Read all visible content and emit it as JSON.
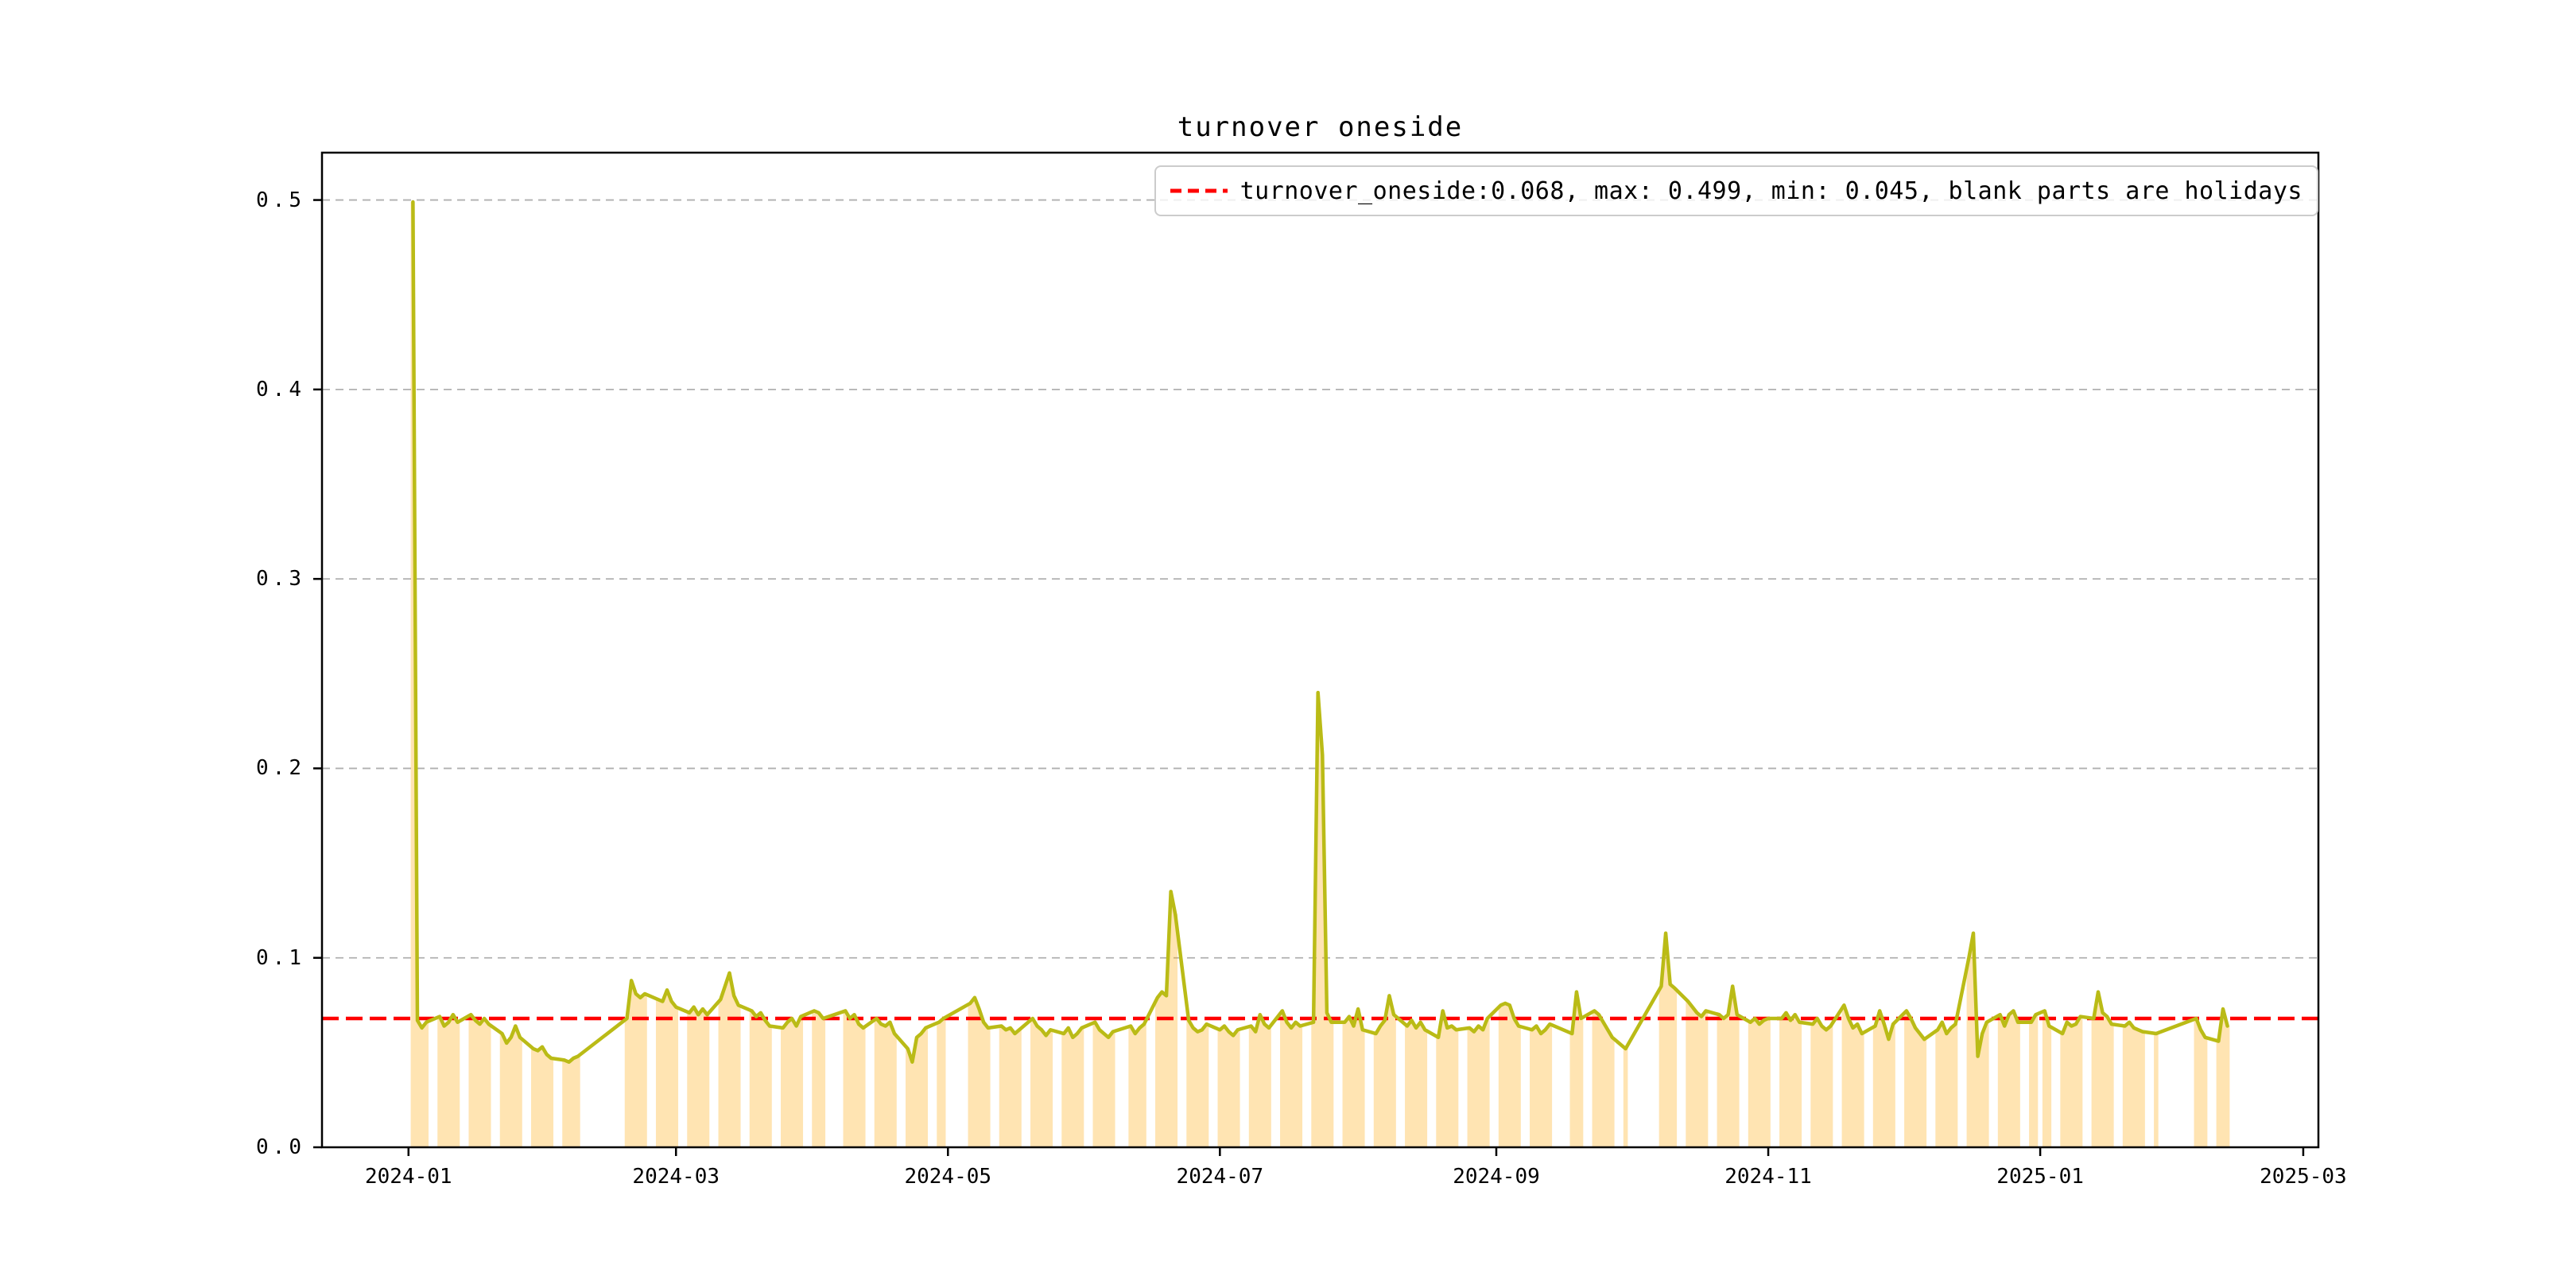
{
  "title": "turnover oneside",
  "legend": {
    "label": "turnover_oneside:0.068, max: 0.499, min: 0.045, blank parts are holidays",
    "dash_icon": "red-dashed-line-sample"
  },
  "colors": {
    "line": "#babb16",
    "fill": "rgba(255,165,0,0.30)",
    "hline": "#ff0000",
    "grid": "#b0b0b0",
    "spine": "#000000",
    "legend_border": "#cccccc"
  },
  "chart_data": {
    "type": "line",
    "title": "turnover oneside",
    "xlabel": "",
    "ylabel": "",
    "grid": true,
    "legend_position": "upper right",
    "hline": 0.068,
    "stats": {
      "turnover_oneside": 0.068,
      "max": 0.499,
      "min": 0.045,
      "note": "blank parts are holidays"
    },
    "ylim": [
      0,
      0.525
    ],
    "x_epoch": "2024-01-01",
    "xlim_days": [
      -19.4,
      428.4
    ],
    "yticks": [
      {
        "v": 0.0,
        "label": "0.0"
      },
      {
        "v": 0.1,
        "label": "0.1"
      },
      {
        "v": 0.2,
        "label": "0.2"
      },
      {
        "v": 0.3,
        "label": "0.3"
      },
      {
        "v": 0.4,
        "label": "0.4"
      },
      {
        "v": 0.5,
        "label": "0.5"
      }
    ],
    "xticks": [
      {
        "date": "2024-01-01",
        "label": "2024-01"
      },
      {
        "date": "2024-03-01",
        "label": "2024-03"
      },
      {
        "date": "2024-05-01",
        "label": "2024-05"
      },
      {
        "date": "2024-07-01",
        "label": "2024-07"
      },
      {
        "date": "2024-09-01",
        "label": "2024-09"
      },
      {
        "date": "2024-11-01",
        "label": "2024-11"
      },
      {
        "date": "2025-01-01",
        "label": "2025-01"
      },
      {
        "date": "2025-03-01",
        "label": "2025-03"
      }
    ],
    "series": [
      [
        "2024-01-02",
        0.499
      ],
      [
        "2024-01-03",
        0.067
      ],
      [
        "2024-01-04",
        0.063
      ],
      [
        "2024-01-05",
        0.066
      ],
      [
        "2024-01-08",
        0.069
      ],
      [
        "2024-01-09",
        0.064
      ],
      [
        "2024-01-10",
        0.066
      ],
      [
        "2024-01-11",
        0.07
      ],
      [
        "2024-01-12",
        0.066
      ],
      [
        "2024-01-15",
        0.07
      ],
      [
        "2024-01-16",
        0.067
      ],
      [
        "2024-01-17",
        0.065
      ],
      [
        "2024-01-18",
        0.068
      ],
      [
        "2024-01-19",
        0.065
      ],
      [
        "2024-01-22",
        0.06
      ],
      [
        "2024-01-23",
        0.055
      ],
      [
        "2024-01-24",
        0.058
      ],
      [
        "2024-01-25",
        0.064
      ],
      [
        "2024-01-26",
        0.058
      ],
      [
        "2024-01-29",
        0.052
      ],
      [
        "2024-01-30",
        0.051
      ],
      [
        "2024-01-31",
        0.053
      ],
      [
        "2024-02-01",
        0.049
      ],
      [
        "2024-02-02",
        0.047
      ],
      [
        "2024-02-05",
        0.046
      ],
      [
        "2024-02-06",
        0.045
      ],
      [
        "2024-02-07",
        0.047
      ],
      [
        "2024-02-08",
        0.048
      ],
      [
        "2024-02-19",
        0.068
      ],
      [
        "2024-02-20",
        0.088
      ],
      [
        "2024-02-21",
        0.081
      ],
      [
        "2024-02-22",
        0.079
      ],
      [
        "2024-02-23",
        0.081
      ],
      [
        "2024-02-26",
        0.078
      ],
      [
        "2024-02-27",
        0.077
      ],
      [
        "2024-02-28",
        0.083
      ],
      [
        "2024-02-29",
        0.077
      ],
      [
        "2024-03-01",
        0.074
      ],
      [
        "2024-03-04",
        0.071
      ],
      [
        "2024-03-05",
        0.074
      ],
      [
        "2024-03-06",
        0.07
      ],
      [
        "2024-03-07",
        0.073
      ],
      [
        "2024-03-08",
        0.07
      ],
      [
        "2024-03-11",
        0.078
      ],
      [
        "2024-03-12",
        0.085
      ],
      [
        "2024-03-13",
        0.092
      ],
      [
        "2024-03-14",
        0.08
      ],
      [
        "2024-03-15",
        0.075
      ],
      [
        "2024-03-18",
        0.072
      ],
      [
        "2024-03-19",
        0.069
      ],
      [
        "2024-03-20",
        0.071
      ],
      [
        "2024-03-21",
        0.067
      ],
      [
        "2024-03-22",
        0.064
      ],
      [
        "2024-03-25",
        0.063
      ],
      [
        "2024-03-26",
        0.066
      ],
      [
        "2024-03-27",
        0.068
      ],
      [
        "2024-03-28",
        0.064
      ],
      [
        "2024-03-29",
        0.069
      ],
      [
        "2024-04-01",
        0.072
      ],
      [
        "2024-04-02",
        0.071
      ],
      [
        "2024-04-03",
        0.068
      ],
      [
        "2024-04-08",
        0.072
      ],
      [
        "2024-04-09",
        0.068
      ],
      [
        "2024-04-10",
        0.07
      ],
      [
        "2024-04-11",
        0.065
      ],
      [
        "2024-04-12",
        0.063
      ],
      [
        "2024-04-15",
        0.068
      ],
      [
        "2024-04-16",
        0.065
      ],
      [
        "2024-04-17",
        0.064
      ],
      [
        "2024-04-18",
        0.066
      ],
      [
        "2024-04-19",
        0.06
      ],
      [
        "2024-04-22",
        0.052
      ],
      [
        "2024-04-23",
        0.045
      ],
      [
        "2024-04-24",
        0.058
      ],
      [
        "2024-04-25",
        0.06
      ],
      [
        "2024-04-26",
        0.063
      ],
      [
        "2024-04-29",
        0.066
      ],
      [
        "2024-04-30",
        0.068
      ],
      [
        "2024-05-06",
        0.076
      ],
      [
        "2024-05-07",
        0.079
      ],
      [
        "2024-05-08",
        0.073
      ],
      [
        "2024-05-09",
        0.066
      ],
      [
        "2024-05-10",
        0.063
      ],
      [
        "2024-05-13",
        0.064
      ],
      [
        "2024-05-14",
        0.062
      ],
      [
        "2024-05-15",
        0.063
      ],
      [
        "2024-05-16",
        0.06
      ],
      [
        "2024-05-17",
        0.062
      ],
      [
        "2024-05-20",
        0.068
      ],
      [
        "2024-05-21",
        0.064
      ],
      [
        "2024-05-22",
        0.062
      ],
      [
        "2024-05-23",
        0.059
      ],
      [
        "2024-05-24",
        0.062
      ],
      [
        "2024-05-27",
        0.06
      ],
      [
        "2024-05-28",
        0.063
      ],
      [
        "2024-05-29",
        0.058
      ],
      [
        "2024-05-30",
        0.06
      ],
      [
        "2024-05-31",
        0.063
      ],
      [
        "2024-06-03",
        0.066
      ],
      [
        "2024-06-04",
        0.062
      ],
      [
        "2024-06-05",
        0.06
      ],
      [
        "2024-06-06",
        0.058
      ],
      [
        "2024-06-07",
        0.061
      ],
      [
        "2024-06-11",
        0.064
      ],
      [
        "2024-06-12",
        0.06
      ],
      [
        "2024-06-13",
        0.063
      ],
      [
        "2024-06-14",
        0.065
      ],
      [
        "2024-06-17",
        0.079
      ],
      [
        "2024-06-18",
        0.082
      ],
      [
        "2024-06-19",
        0.08
      ],
      [
        "2024-06-20",
        0.135
      ],
      [
        "2024-06-21",
        0.123
      ],
      [
        "2024-06-24",
        0.067
      ],
      [
        "2024-06-25",
        0.063
      ],
      [
        "2024-06-26",
        0.061
      ],
      [
        "2024-06-27",
        0.062
      ],
      [
        "2024-06-28",
        0.065
      ],
      [
        "2024-07-01",
        0.062
      ],
      [
        "2024-07-02",
        0.064
      ],
      [
        "2024-07-03",
        0.061
      ],
      [
        "2024-07-04",
        0.059
      ],
      [
        "2024-07-05",
        0.062
      ],
      [
        "2024-07-08",
        0.064
      ],
      [
        "2024-07-09",
        0.061
      ],
      [
        "2024-07-10",
        0.07
      ],
      [
        "2024-07-11",
        0.065
      ],
      [
        "2024-07-12",
        0.063
      ],
      [
        "2024-07-15",
        0.072
      ],
      [
        "2024-07-16",
        0.066
      ],
      [
        "2024-07-17",
        0.063
      ],
      [
        "2024-07-18",
        0.066
      ],
      [
        "2024-07-19",
        0.064
      ],
      [
        "2024-07-22",
        0.066
      ],
      [
        "2024-07-23",
        0.24
      ],
      [
        "2024-07-24",
        0.207
      ],
      [
        "2024-07-25",
        0.071
      ],
      [
        "2024-07-26",
        0.066
      ],
      [
        "2024-07-29",
        0.066
      ],
      [
        "2024-07-30",
        0.069
      ],
      [
        "2024-07-31",
        0.064
      ],
      [
        "2024-08-01",
        0.073
      ],
      [
        "2024-08-02",
        0.062
      ],
      [
        "2024-08-05",
        0.06
      ],
      [
        "2024-08-06",
        0.064
      ],
      [
        "2024-08-07",
        0.067
      ],
      [
        "2024-08-08",
        0.08
      ],
      [
        "2024-08-09",
        0.07
      ],
      [
        "2024-08-12",
        0.064
      ],
      [
        "2024-08-13",
        0.067
      ],
      [
        "2024-08-14",
        0.063
      ],
      [
        "2024-08-15",
        0.066
      ],
      [
        "2024-08-16",
        0.062
      ],
      [
        "2024-08-19",
        0.058
      ],
      [
        "2024-08-20",
        0.072
      ],
      [
        "2024-08-21",
        0.063
      ],
      [
        "2024-08-22",
        0.064
      ],
      [
        "2024-08-23",
        0.062
      ],
      [
        "2024-08-26",
        0.063
      ],
      [
        "2024-08-27",
        0.061
      ],
      [
        "2024-08-28",
        0.064
      ],
      [
        "2024-08-29",
        0.062
      ],
      [
        "2024-08-30",
        0.068
      ],
      [
        "2024-09-02",
        0.075
      ],
      [
        "2024-09-03",
        0.076
      ],
      [
        "2024-09-04",
        0.075
      ],
      [
        "2024-09-05",
        0.068
      ],
      [
        "2024-09-06",
        0.064
      ],
      [
        "2024-09-09",
        0.062
      ],
      [
        "2024-09-10",
        0.064
      ],
      [
        "2024-09-11",
        0.06
      ],
      [
        "2024-09-12",
        0.062
      ],
      [
        "2024-09-13",
        0.065
      ],
      [
        "2024-09-18",
        0.06
      ],
      [
        "2024-09-19",
        0.082
      ],
      [
        "2024-09-20",
        0.068
      ],
      [
        "2024-09-23",
        0.072
      ],
      [
        "2024-09-24",
        0.07
      ],
      [
        "2024-09-25",
        0.066
      ],
      [
        "2024-09-26",
        0.062
      ],
      [
        "2024-09-27",
        0.058
      ],
      [
        "2024-09-30",
        0.052
      ],
      [
        "2024-10-08",
        0.085
      ],
      [
        "2024-10-09",
        0.113
      ],
      [
        "2024-10-10",
        0.086
      ],
      [
        "2024-10-11",
        0.084
      ],
      [
        "2024-10-14",
        0.077
      ],
      [
        "2024-10-15",
        0.074
      ],
      [
        "2024-10-16",
        0.071
      ],
      [
        "2024-10-17",
        0.069
      ],
      [
        "2024-10-18",
        0.072
      ],
      [
        "2024-10-21",
        0.07
      ],
      [
        "2024-10-22",
        0.068
      ],
      [
        "2024-10-23",
        0.07
      ],
      [
        "2024-10-24",
        0.085
      ],
      [
        "2024-10-25",
        0.07
      ],
      [
        "2024-10-28",
        0.066
      ],
      [
        "2024-10-29",
        0.068
      ],
      [
        "2024-10-30",
        0.065
      ],
      [
        "2024-10-31",
        0.067
      ],
      [
        "2024-11-01",
        0.068
      ],
      [
        "2024-11-04",
        0.068
      ],
      [
        "2024-11-05",
        0.071
      ],
      [
        "2024-11-06",
        0.067
      ],
      [
        "2024-11-07",
        0.07
      ],
      [
        "2024-11-08",
        0.066
      ],
      [
        "2024-11-11",
        0.065
      ],
      [
        "2024-11-12",
        0.068
      ],
      [
        "2024-11-13",
        0.064
      ],
      [
        "2024-11-14",
        0.062
      ],
      [
        "2024-11-15",
        0.064
      ],
      [
        "2024-11-18",
        0.075
      ],
      [
        "2024-11-19",
        0.068
      ],
      [
        "2024-11-20",
        0.063
      ],
      [
        "2024-11-21",
        0.065
      ],
      [
        "2024-11-22",
        0.06
      ],
      [
        "2024-11-25",
        0.064
      ],
      [
        "2024-11-26",
        0.072
      ],
      [
        "2024-11-27",
        0.065
      ],
      [
        "2024-11-28",
        0.057
      ],
      [
        "2024-11-29",
        0.065
      ],
      [
        "2024-12-02",
        0.072
      ],
      [
        "2024-12-03",
        0.068
      ],
      [
        "2024-12-04",
        0.063
      ],
      [
        "2024-12-05",
        0.06
      ],
      [
        "2024-12-06",
        0.057
      ],
      [
        "2024-12-09",
        0.062
      ],
      [
        "2024-12-10",
        0.066
      ],
      [
        "2024-12-11",
        0.06
      ],
      [
        "2024-12-12",
        0.063
      ],
      [
        "2024-12-13",
        0.065
      ],
      [
        "2024-12-16",
        0.1
      ],
      [
        "2024-12-17",
        0.113
      ],
      [
        "2024-12-18",
        0.048
      ],
      [
        "2024-12-19",
        0.06
      ],
      [
        "2024-12-20",
        0.066
      ],
      [
        "2024-12-23",
        0.07
      ],
      [
        "2024-12-24",
        0.064
      ],
      [
        "2024-12-25",
        0.07
      ],
      [
        "2024-12-26",
        0.072
      ],
      [
        "2024-12-27",
        0.066
      ],
      [
        "2024-12-30",
        0.066
      ],
      [
        "2024-12-31",
        0.07
      ],
      [
        "2025-01-02",
        0.072
      ],
      [
        "2025-01-03",
        0.064
      ],
      [
        "2025-01-06",
        0.06
      ],
      [
        "2025-01-07",
        0.066
      ],
      [
        "2025-01-08",
        0.064
      ],
      [
        "2025-01-09",
        0.065
      ],
      [
        "2025-01-10",
        0.069
      ],
      [
        "2025-01-13",
        0.068
      ],
      [
        "2025-01-14",
        0.082
      ],
      [
        "2025-01-15",
        0.071
      ],
      [
        "2025-01-16",
        0.069
      ],
      [
        "2025-01-17",
        0.065
      ],
      [
        "2025-01-20",
        0.064
      ],
      [
        "2025-01-21",
        0.066
      ],
      [
        "2025-01-22",
        0.063
      ],
      [
        "2025-01-23",
        0.062
      ],
      [
        "2025-01-24",
        0.061
      ],
      [
        "2025-01-27",
        0.06
      ],
      [
        "2025-02-05",
        0.068
      ],
      [
        "2025-02-06",
        0.062
      ],
      [
        "2025-02-07",
        0.058
      ],
      [
        "2025-02-10",
        0.056
      ],
      [
        "2025-02-11",
        0.073
      ],
      [
        "2025-02-12",
        0.064
      ]
    ]
  }
}
